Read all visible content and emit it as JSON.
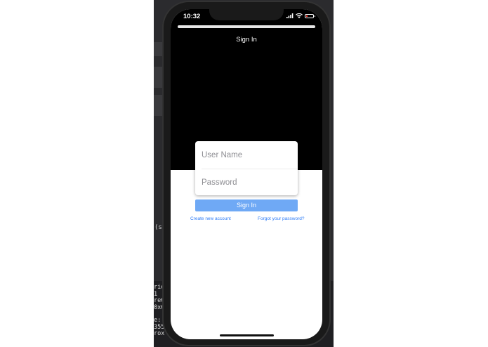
{
  "status_bar": {
    "time": "10:32",
    "icons": [
      "signal-icon",
      "wifi-icon",
      "battery-icon"
    ],
    "battery_color": "#ff3b30"
  },
  "nav": {
    "title": "Sign In"
  },
  "login": {
    "username_placeholder": "User Name",
    "password_placeholder": "Password",
    "username_value": "",
    "password_value": "",
    "sign_in_label": "Sign In",
    "sign_in_color": "#6fa9f5",
    "create_account_label": "Create new account",
    "forgot_password_label": "Forgot your password?",
    "link_color": "#2f7cf6"
  },
  "background_window": {
    "side_text": "(s:",
    "console_lines": [
      "rie",
      "1 :",
      "re6",
      "0x6",
      "",
      "e: (",
      "355",
      "rox"
    ]
  }
}
